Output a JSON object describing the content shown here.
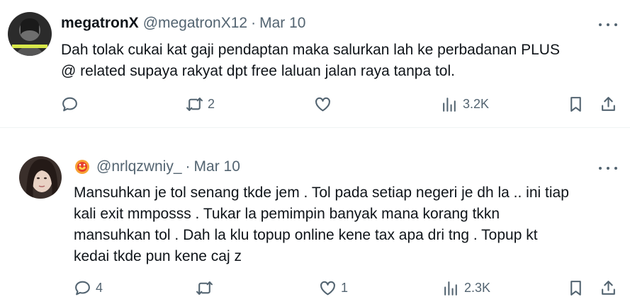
{
  "tweets": [
    {
      "display_name": "megatronX",
      "handle": "@megatronX12",
      "separator": "·",
      "date": "Mar 10",
      "lines": [
        "Dah tolak cukai kat gaji pendaptan maka salurkan lah ke perbadanan PLUS",
        "@ related supaya rakyat dpt free laluan jalan raya tanpa tol."
      ],
      "reply_count": "",
      "retweet_count": "2",
      "like_count": "",
      "view_count": "3.2K"
    },
    {
      "handle": "@nrlqzwniy_",
      "separator": "·",
      "date": "Mar 10",
      "lines": [
        "Mansuhkan je tol senang tkde jem . Tol pada setiap negeri je dh la .. ini tiap",
        "kali exit mmposss . Tukar la pemimpin banyak mana korang tkkn",
        "mansuhkan tol . Dah la klu topup online kene tax apa dri tng . Topup kt",
        "kedai tkde pun kene caj z"
      ],
      "reply_count": "4",
      "retweet_count": "",
      "like_count": "1",
      "view_count": "2.3K"
    }
  ],
  "colors": {
    "text_primary": "#0f1419",
    "text_secondary": "#536471",
    "divider": "#eff3f4"
  },
  "icons": [
    "reply-icon",
    "retweet-icon",
    "like-icon",
    "views-icon",
    "bookmark-icon",
    "share-icon",
    "more-icon",
    "badge-icon"
  ]
}
